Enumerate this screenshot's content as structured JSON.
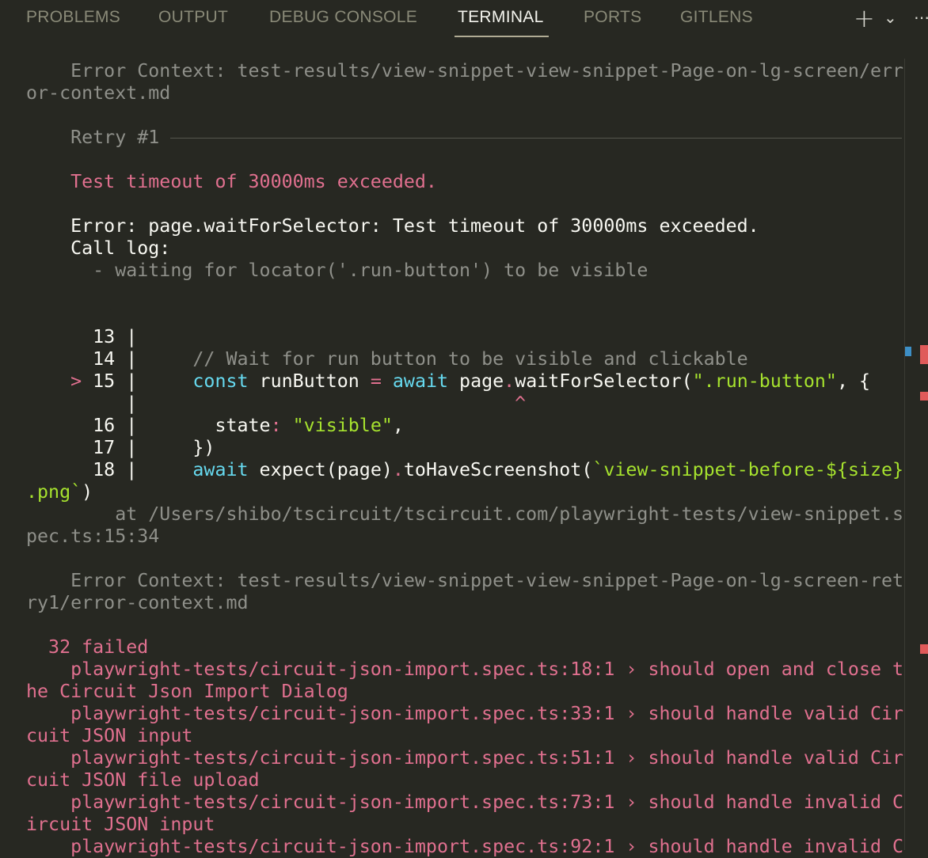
{
  "tabs": [
    {
      "label": "PROBLEMS",
      "active": false
    },
    {
      "label": "OUTPUT",
      "active": false
    },
    {
      "label": "DEBUG CONSOLE",
      "active": false
    },
    {
      "label": "TERMINAL",
      "active": true
    },
    {
      "label": "PORTS",
      "active": false
    },
    {
      "label": "GITLENS",
      "active": false
    }
  ],
  "toolbar": {
    "new_terminal_icon": "plus-icon",
    "dropdown_icon": "chevron-down-icon",
    "more_icon": "ellipsis-icon",
    "new_terminal_glyph": "+",
    "dropdown_glyph": "⌄",
    "more_glyph": "⋯"
  },
  "colors": {
    "background": "#272822",
    "dim": "#8f908a",
    "pink": "#e0708f",
    "cyan": "#66d9ef",
    "green": "#a6e22e",
    "text": "#f8f8f2"
  },
  "terminal_lines": [
    [
      [
        "    Error Context: test-results/view-snippet-view-snippet-Page-on-lg-screen/err",
        "dim"
      ]
    ],
    [
      [
        "or-context.md",
        "dim"
      ]
    ],
    [],
    [
      [
        "    Retry #1",
        "dim"
      ],
      [
        "__RULE__",
        "dim"
      ]
    ],
    [],
    [
      [
        "    Test timeout of 30000ms exceeded.",
        "pink"
      ]
    ],
    [],
    [
      [
        "    Error: page.waitForSelector: Test timeout of 30000ms exceeded.",
        "white"
      ]
    ],
    [
      [
        "    Call log:",
        "white"
      ]
    ],
    [
      [
        "      - waiting for locator('.run-button') to be visible",
        "dim"
      ]
    ],
    [],
    [],
    [
      [
        "      13 |",
        "white"
      ]
    ],
    [
      [
        "      14 |     ",
        "white"
      ],
      [
        "// Wait for run button to be visible and clickable",
        "dim"
      ]
    ],
    [
      [
        "    > ",
        "pink"
      ],
      [
        "15 |     ",
        "white"
      ],
      [
        "const",
        "cyan"
      ],
      [
        " runButton ",
        "white"
      ],
      [
        "=",
        "pink"
      ],
      [
        " ",
        "white"
      ],
      [
        "await",
        "cyan"
      ],
      [
        " page",
        "white"
      ],
      [
        ".",
        "pink"
      ],
      [
        "waitForSelector(",
        "white"
      ],
      [
        "\".run-button\"",
        "green"
      ],
      [
        ", {",
        "white"
      ]
    ],
    [
      [
        "         |",
        "white"
      ],
      [
        "                                  ^",
        "pink"
      ]
    ],
    [
      [
        "      16 |       state",
        "white"
      ],
      [
        ":",
        "pink"
      ],
      [
        " ",
        "white"
      ],
      [
        "\"visible\"",
        "green"
      ],
      [
        ",",
        "white"
      ]
    ],
    [
      [
        "      17 |     })",
        "white"
      ]
    ],
    [
      [
        "      18 |     ",
        "white"
      ],
      [
        "await",
        "cyan"
      ],
      [
        " expect(page)",
        "white"
      ],
      [
        ".",
        "pink"
      ],
      [
        "toHaveScreenshot(",
        "white"
      ],
      [
        "`view-snippet-before-${size}",
        "green"
      ]
    ],
    [
      [
        ".png`",
        "green"
      ],
      [
        ")",
        "white"
      ]
    ],
    [
      [
        "        at /Users/shibo/tscircuit/tscircuit.com/playwright-tests/view-snippet.s",
        "dim"
      ]
    ],
    [
      [
        "pec.ts:15:34",
        "dim"
      ]
    ],
    [],
    [
      [
        "    Error Context: test-results/view-snippet-view-snippet-Page-on-lg-screen-ret",
        "dim"
      ]
    ],
    [
      [
        "ry1/error-context.md",
        "dim"
      ]
    ],
    [],
    [
      [
        "  32 failed",
        "pink"
      ]
    ],
    [
      [
        "    playwright-tests/circuit-json-import.spec.ts:18:1 › should open and close t",
        "pink"
      ]
    ],
    [
      [
        "he Circuit Json Import Dialog",
        "pink"
      ]
    ],
    [
      [
        "    playwright-tests/circuit-json-import.spec.ts:33:1 › should handle valid Cir",
        "pink"
      ]
    ],
    [
      [
        "cuit JSON input",
        "pink"
      ]
    ],
    [
      [
        "    playwright-tests/circuit-json-import.spec.ts:51:1 › should handle valid Cir",
        "pink"
      ]
    ],
    [
      [
        "cuit JSON file upload",
        "pink"
      ]
    ],
    [
      [
        "    playwright-tests/circuit-json-import.spec.ts:73:1 › should handle invalid C",
        "pink"
      ]
    ],
    [
      [
        "ircuit JSON input",
        "pink"
      ]
    ],
    [
      [
        "    playwright-tests/circuit-json-import.spec.ts:92:1 › should handle invalid C",
        "pink"
      ]
    ]
  ]
}
